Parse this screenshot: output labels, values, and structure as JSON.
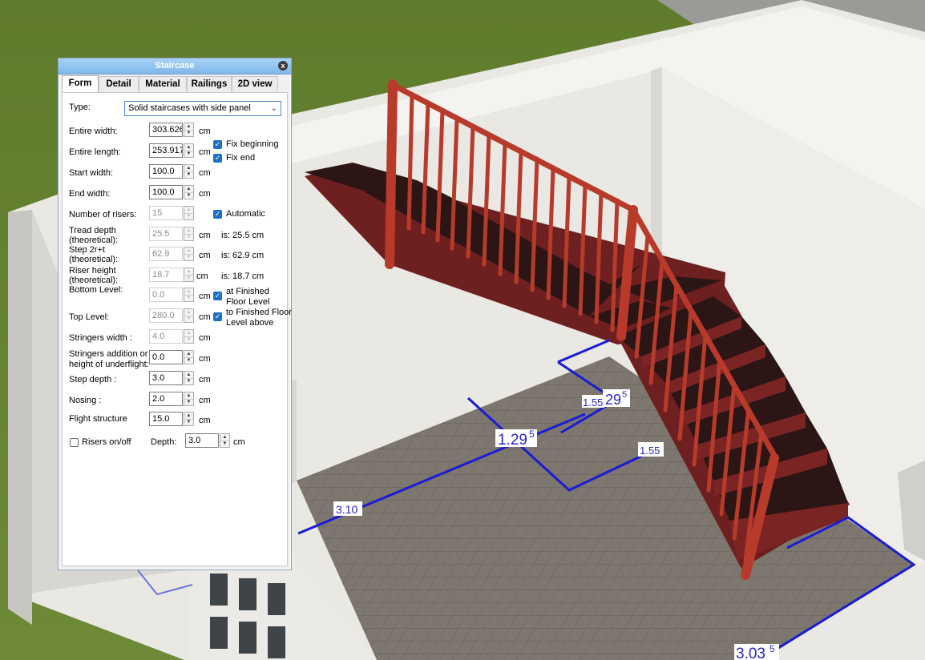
{
  "dialog": {
    "title": "Staircase",
    "close_symbol": "x",
    "tabs": [
      "Form",
      "Detail",
      "Material",
      "Railings",
      "2D view"
    ],
    "active_tab": "Form",
    "type": {
      "label": "Type:",
      "value": "Solid staircases with side panel"
    },
    "rows": {
      "entire_width": {
        "label": "Entire width:",
        "value": "303.626",
        "unit": "cm"
      },
      "entire_length": {
        "label": "Entire length:",
        "value": "253.917",
        "unit": "cm"
      },
      "start_width": {
        "label": "Start width:",
        "value": "100.0",
        "unit": "cm"
      },
      "end_width": {
        "label": "End width:",
        "value": "100.0",
        "unit": "cm"
      },
      "risers": {
        "label": "Number of risers:",
        "value": "15"
      },
      "tread_depth": {
        "label1": "Tread depth",
        "label2": "(theoretical):",
        "value": "25.5",
        "unit": "cm",
        "is": "is: 25.5 cm"
      },
      "step": {
        "label1": "Step 2r+t",
        "label2": "(theoretical):",
        "value": "62.9",
        "unit": "cm",
        "is": "is: 62.9 cm"
      },
      "riser_height": {
        "label1": "Riser height",
        "label2": "(theoretical):",
        "value": "18.7",
        "unit": "cm",
        "is": "is: 18.7 cm"
      },
      "bottom_level": {
        "label": "Bottom Level:",
        "value": "0.0",
        "unit": "cm"
      },
      "top_level": {
        "label": "Top Level:",
        "value": "280.0",
        "unit": "cm"
      },
      "stringers_width": {
        "label": "Stringers width :",
        "value": "4.0",
        "unit": "cm"
      },
      "stringers_addition": {
        "label1": "Stringers addition or",
        "label2": "height of underflight:",
        "value": "0.0",
        "unit": "cm"
      },
      "step_depth": {
        "label": "Step depth :",
        "value": "3.0",
        "unit": "cm"
      },
      "nosing": {
        "label": "Nosing :",
        "value": "2.0",
        "unit": "cm"
      },
      "flight_structure": {
        "label": "Flight structure",
        "value": "15.0",
        "unit": "cm"
      },
      "risers_onoff": {
        "label": "Risers on/off",
        "checked": false
      },
      "depth": {
        "label": "Depth:",
        "value": "3.0",
        "unit": "cm"
      }
    },
    "checks": {
      "fix_beginning": {
        "label": "Fix beginning",
        "checked": true
      },
      "fix_end": {
        "label": "Fix end",
        "checked": true
      },
      "automatic": {
        "label": "Automatic",
        "checked": true
      },
      "finished_floor": {
        "label1": "at Finished",
        "label2": "Floor Level",
        "checked": true
      },
      "finished_floor_above": {
        "label1": "to Finished Floor",
        "label2": "Level above",
        "checked": true
      }
    }
  },
  "scene": {
    "dimensions": {
      "d310": "3.10",
      "d129a": "1.29",
      "d129a_sup": "5",
      "d155a": "1.55",
      "d129b": "29",
      "d129b_sup": "5",
      "d155b": "1.55",
      "d303": "3.03",
      "d303_sup": "5"
    },
    "colors": {
      "grass": "#5f7a2e",
      "wall": "#f2f1ec",
      "floor_tile": "#7d7770",
      "stair_tread": "#2b1515",
      "stair_riser": "#6e1f1f",
      "railing": "#b83a2a",
      "dimension_line": "#1b1bd6"
    }
  }
}
